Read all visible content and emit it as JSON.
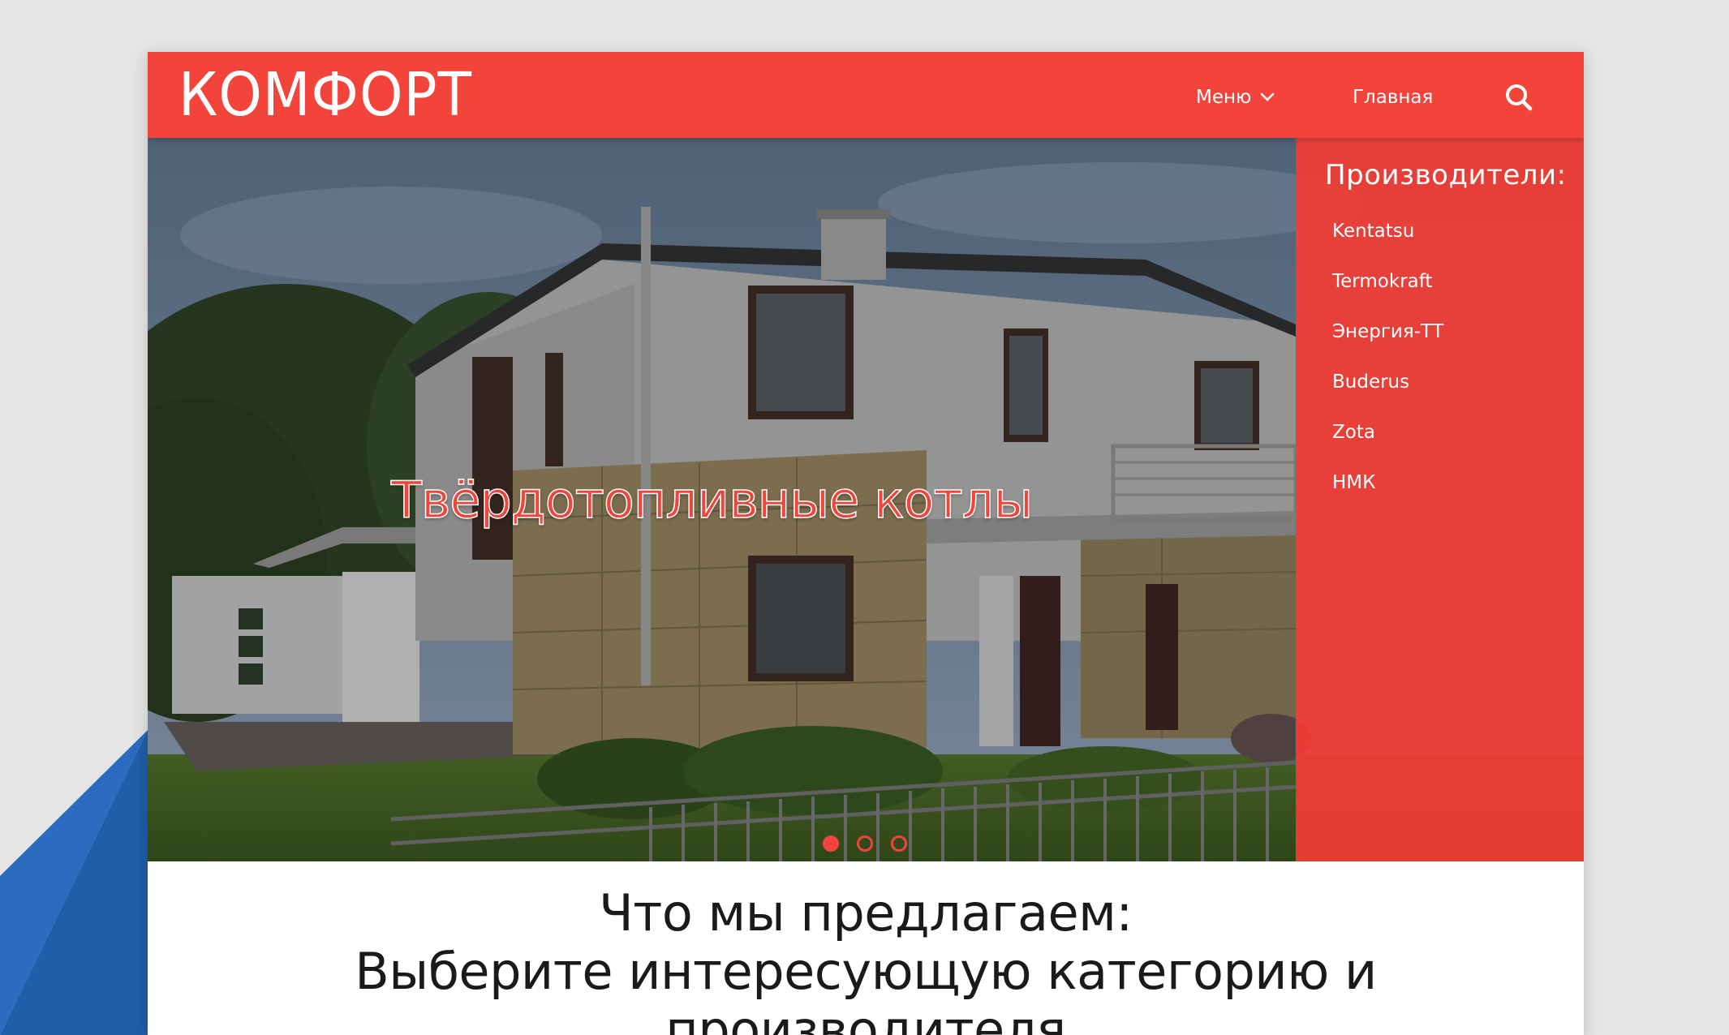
{
  "header": {
    "logo": "КОМФОРТ",
    "menu_label": "Меню",
    "home_label": "Главная"
  },
  "hero": {
    "title": "Твёрдотопливные котлы",
    "slides_count": 3,
    "active_slide": 1
  },
  "manufacturers": {
    "title": "Производители:",
    "items": [
      "Kentatsu",
      "Termokraft",
      "Энергия-ТТ",
      "Buderus",
      "Zota",
      "НМК"
    ]
  },
  "content": {
    "heading_line1": "Что мы предлагаем:",
    "heading_line2": "Выберите интересующую категорию и производителя"
  },
  "colors": {
    "accent": "#f2443a",
    "background": "#e5e5e5",
    "corner_blue": "#1f5ea8"
  }
}
